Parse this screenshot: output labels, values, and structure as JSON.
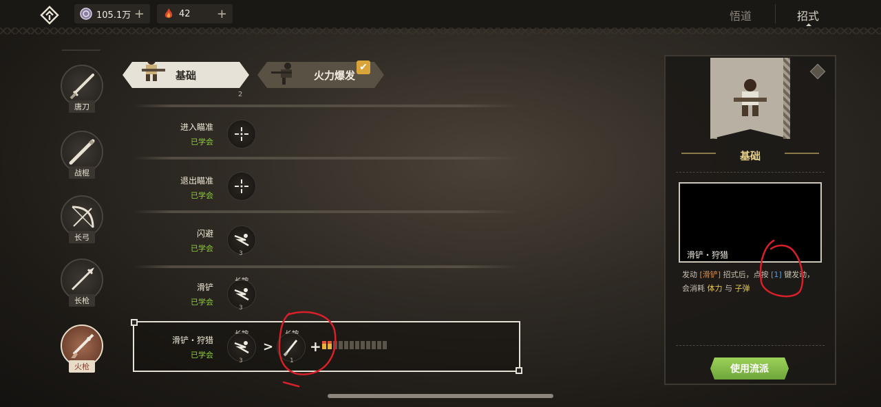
{
  "topbar": {
    "resources": [
      {
        "icon": "silver-coin-icon",
        "value": "105.1万"
      },
      {
        "icon": "flame-crystal-icon",
        "value": "42"
      }
    ],
    "tabs": [
      {
        "label": "悟道",
        "active": false
      },
      {
        "label": "招式",
        "active": true
      }
    ]
  },
  "weapons": [
    {
      "label": "唐刀",
      "icon": "katana-icon",
      "active": false
    },
    {
      "label": "战棍",
      "icon": "staff-icon",
      "active": false
    },
    {
      "label": "长弓",
      "icon": "longbow-icon",
      "active": false
    },
    {
      "label": "长枪",
      "icon": "spear-icon",
      "active": false
    },
    {
      "label": "火枪",
      "icon": "musket-icon",
      "active": true
    }
  ],
  "style_tabs": [
    {
      "label": "基础",
      "active": true
    },
    {
      "label": "火力爆发",
      "active": false,
      "checked": true
    }
  ],
  "tier_number": "2",
  "moves": [
    {
      "name": "进入瞄准",
      "status": "已学会",
      "icon": "crosshair-icon"
    },
    {
      "name": "退出瞄准",
      "status": "已学会",
      "icon": "crosshair-icon"
    },
    {
      "name": "闪避",
      "status": "已学会",
      "icon": "dash-icon",
      "count": "3"
    },
    {
      "name": "滑铲",
      "status": "已学会",
      "icon": "dash-icon",
      "hold": "长按",
      "count": "3"
    },
    {
      "name": "滑铲・狩猎",
      "status": "已学会",
      "icon": "dash-icon",
      "hold": "长按",
      "count": "3",
      "combo": {
        "hold": "长按",
        "icon": "musket-shot-icon",
        "count": "1",
        "bullets_total": 12,
        "bullets_lit": 2
      }
    }
  ],
  "detail": {
    "title": "基础",
    "video_caption": "滑铲・狩猎",
    "desc_parts": {
      "p1": "发动",
      "p2": "[滑铲]",
      "p3": "招式后，点按",
      "p4": "[1]",
      "p5": "键发动，会消耗",
      "p6": "体力",
      "p7": "与",
      "p8": "子弹"
    },
    "button": "使用流派"
  },
  "colors": {
    "learned": "#8ecf3a",
    "accent_gold": "#e8d28a",
    "button_green": "#7fbb45",
    "annotation_red": "#d8202a"
  }
}
